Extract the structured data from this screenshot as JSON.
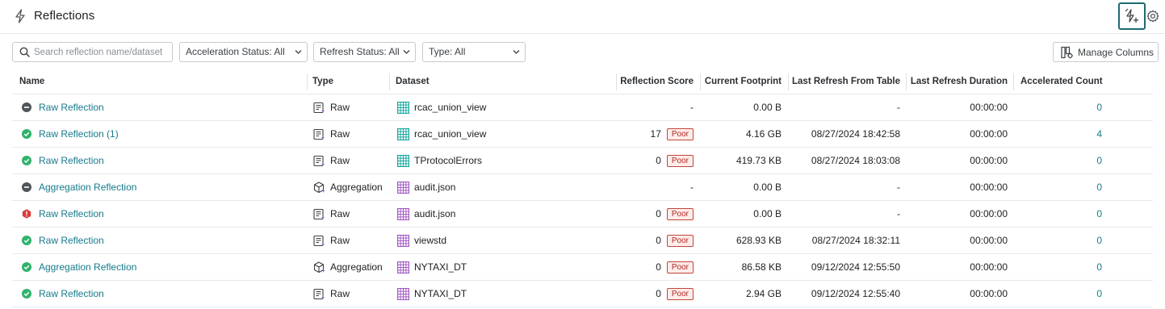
{
  "header": {
    "title": "Reflections"
  },
  "toolbar": {
    "search_placeholder": "Search reflection name/dataset",
    "filters": [
      {
        "label": "Acceleration Status: All"
      },
      {
        "label": "Refresh Status: All"
      },
      {
        "label": "Type: All"
      }
    ],
    "manage_columns_label": "Manage Columns"
  },
  "table": {
    "columns": [
      "Name",
      "Type",
      "Dataset",
      "Reflection Score",
      "Current Footprint",
      "Last Refresh From Table",
      "Last Refresh Duration",
      "Accelerated Count"
    ],
    "rows": [
      {
        "status": "disabled",
        "name": "Raw Reflection",
        "type": "Raw",
        "dataset_kind": "view",
        "dataset": "rcac_union_view",
        "score": "-",
        "score_badge": "",
        "footprint": "0.00 B",
        "last_refresh": "-",
        "duration": "00:00:00",
        "accelerated": "0"
      },
      {
        "status": "ok",
        "name": "Raw Reflection (1)",
        "type": "Raw",
        "dataset_kind": "view",
        "dataset": "rcac_union_view",
        "score": "17",
        "score_badge": "Poor",
        "footprint": "4.16 GB",
        "last_refresh": "08/27/2024 18:42:58",
        "duration": "00:00:00",
        "accelerated": "4"
      },
      {
        "status": "ok",
        "name": "Raw Reflection",
        "type": "Raw",
        "dataset_kind": "view",
        "dataset": "TProtocolErrors",
        "score": "0",
        "score_badge": "Poor",
        "footprint": "419.73 KB",
        "last_refresh": "08/27/2024 18:03:08",
        "duration": "00:00:00",
        "accelerated": "0"
      },
      {
        "status": "disabled",
        "name": "Aggregation Reflection",
        "type": "Aggregation",
        "dataset_kind": "table",
        "dataset": "audit.json",
        "score": "-",
        "score_badge": "",
        "footprint": "0.00 B",
        "last_refresh": "-",
        "duration": "00:00:00",
        "accelerated": "0"
      },
      {
        "status": "error",
        "name": "Raw Reflection",
        "type": "Raw",
        "dataset_kind": "table",
        "dataset": "audit.json",
        "score": "0",
        "score_badge": "Poor",
        "footprint": "0.00 B",
        "last_refresh": "-",
        "duration": "00:00:00",
        "accelerated": "0"
      },
      {
        "status": "ok",
        "name": "Raw Reflection",
        "type": "Raw",
        "dataset_kind": "table",
        "dataset": "viewstd",
        "score": "0",
        "score_badge": "Poor",
        "footprint": "628.93 KB",
        "last_refresh": "08/27/2024 18:32:11",
        "duration": "00:00:00",
        "accelerated": "0"
      },
      {
        "status": "ok",
        "name": "Aggregation Reflection",
        "type": "Aggregation",
        "dataset_kind": "table",
        "dataset": "NYTAXI_DT",
        "score": "0",
        "score_badge": "Poor",
        "footprint": "86.58 KB",
        "last_refresh": "09/12/2024 12:55:50",
        "duration": "00:00:00",
        "accelerated": "0"
      },
      {
        "status": "ok",
        "name": "Raw Reflection",
        "type": "Raw",
        "dataset_kind": "table",
        "dataset": "NYTAXI_DT",
        "score": "0",
        "score_badge": "Poor",
        "footprint": "2.94 GB",
        "last_refresh": "09/12/2024 12:55:40",
        "duration": "00:00:00",
        "accelerated": "0"
      }
    ]
  },
  "colors": {
    "link": "#157a8c",
    "status_ok": "#2fb36b",
    "status_disabled": "#505559",
    "status_error": "#d93b3b",
    "poor_border": "#c4443a",
    "poor_bg": "#fdecea",
    "view_dataset": "#16a7a0",
    "table_dataset": "#a25ac4",
    "highlight_border": "#1e6a72"
  },
  "icons": {
    "title": "lightning-icon",
    "recommendations": "lightning-sparkle-icon",
    "settings": "gear-icon",
    "search": "search-icon",
    "manage_columns": "columns-gear-icon"
  }
}
